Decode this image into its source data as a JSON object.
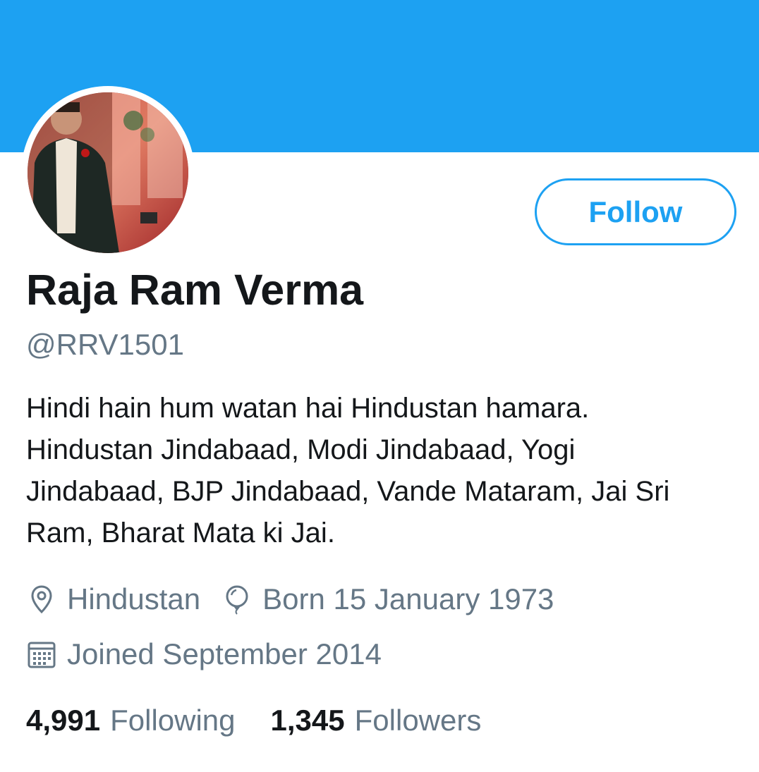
{
  "profile": {
    "name": "Raja Ram Verma",
    "handle": "@RRV1501",
    "bio_lines": [
      "Hindi hain hum watan hai Hindustan hamara.",
      "Hindustan Jindabaad, Modi Jindabaad, Yogi",
      "Jindabaad, BJP Jindabaad, Vande Mataram, Jai Sri",
      "Ram, Bharat Mata ki Jai."
    ],
    "location": "Hindustan",
    "birthday": "Born 15 January 1973",
    "joined": "Joined September 2014"
  },
  "actions": {
    "follow_label": "Follow"
  },
  "stats": {
    "following_count": "4,991",
    "following_label": "Following",
    "followers_count": "1,345",
    "followers_label": "Followers"
  },
  "icons": {
    "location": "location-pin-icon",
    "birthday": "balloon-icon",
    "joined": "calendar-icon"
  },
  "colors": {
    "accent": "#1da1f2",
    "primary_text": "#14171a",
    "secondary_text": "#657786",
    "background": "#ffffff"
  }
}
